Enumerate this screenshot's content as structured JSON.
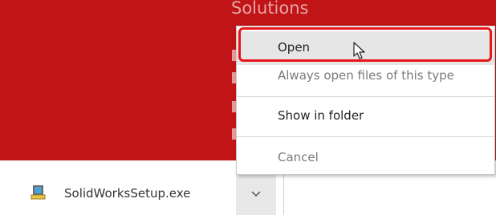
{
  "banner": {
    "title": "Solutions",
    "color": "#c11416"
  },
  "download": {
    "file_name": "SolidWorksSetup.exe",
    "file_icon": "installer-icon",
    "arrow_icon": "chevron-down-icon"
  },
  "context_menu": {
    "items": [
      {
        "label": "Open",
        "enabled": true,
        "hovered": true
      },
      {
        "label": "Always open files of this type",
        "enabled": false
      },
      {
        "label": "Show in folder",
        "enabled": true
      },
      {
        "label": "Cancel",
        "enabled": false
      }
    ],
    "highlight_color": "#e8141a"
  },
  "pointer": {
    "icon": "mouse-pointer-icon"
  }
}
